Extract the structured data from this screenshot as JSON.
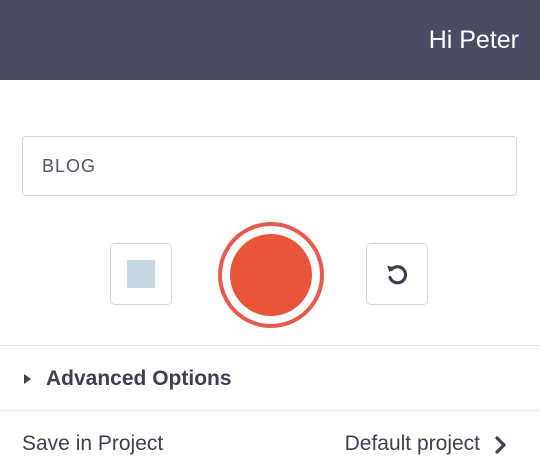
{
  "header": {
    "greeting": "Hi Peter"
  },
  "recorder": {
    "name_value": "BLOG",
    "stop_icon": "square-stop-icon",
    "record_icon": "record-dot-icon",
    "reset_icon": "rotate-ccw-icon"
  },
  "advanced": {
    "label": "Advanced Options",
    "icon": "caret-right-icon"
  },
  "save": {
    "label": "Save in Project",
    "value": "Default project",
    "icon": "chevron-right-icon"
  },
  "colors": {
    "header_bg": "#4b4b63",
    "record": "#e8553b",
    "text": "#3f3f52"
  }
}
